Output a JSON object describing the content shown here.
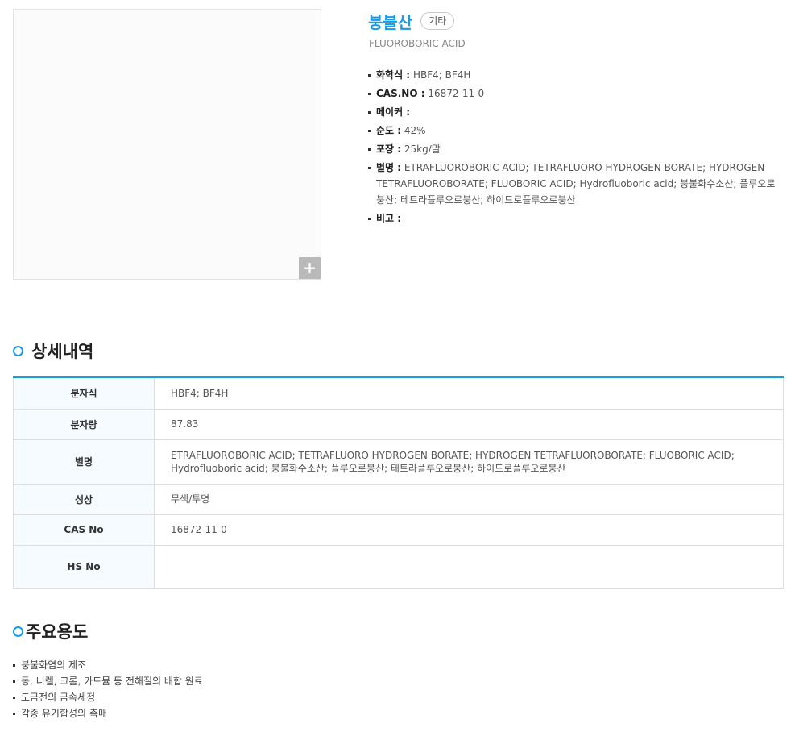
{
  "product": {
    "name": "붕불산",
    "category_badge": "기타",
    "english_name": "FLUOROBORIC ACID",
    "zoom_icon": "plus-icon",
    "properties": [
      {
        "label": "화학식 :",
        "value": "HBF4; BF4H"
      },
      {
        "label": "CAS.NO :",
        "value": "16872-11-0"
      },
      {
        "label": "메이커 :",
        "value": ""
      },
      {
        "label": "순도 :",
        "value": "42%"
      },
      {
        "label": "포장 :",
        "value": "25kg/말"
      },
      {
        "label": "별명 :",
        "value": "ETRAFLUOROBORIC ACID; TETRAFLUORO HYDROGEN BORATE; HYDROGEN TETRAFLUOROBORATE; FLUOBORIC ACID; Hydrofluoboric acid; 붕불화수소산; 플루오로붕산; 테트라플루오로붕산; 하이드로플루오로붕산"
      },
      {
        "label": "비고 :",
        "value": ""
      }
    ]
  },
  "details": {
    "title": "상세내역",
    "rows": [
      {
        "label": "분자식",
        "value": "HBF4; BF4H"
      },
      {
        "label": "분자량",
        "value": "87.83"
      },
      {
        "label": "별명",
        "value": "ETRAFLUOROBORIC ACID; TETRAFLUORO HYDROGEN BORATE; HYDROGEN TETRAFLUOROBORATE; FLUOBORIC ACID; Hydrofluoboric acid; 붕불화수소산; 플루오로붕산; 테트라플루오로붕산; 하이드로플루오로붕산"
      },
      {
        "label": "성상",
        "value": "무색/투명"
      },
      {
        "label": "CAS No",
        "value": "16872-11-0"
      },
      {
        "label": "HS No",
        "value": ""
      }
    ]
  },
  "uses": {
    "title": "주요용도",
    "items": [
      "붕불화염의 제조",
      "동, 니켈, 크롬, 카드뮴 등 전해질의 배합 원료",
      "도금전의 금속세정",
      "각종 유기합성의 촉매"
    ]
  },
  "colors": {
    "accent": "#1a9be6",
    "header_cell_bg": "#f5fbff",
    "zoom_button_bg": "#b9b9b9"
  }
}
